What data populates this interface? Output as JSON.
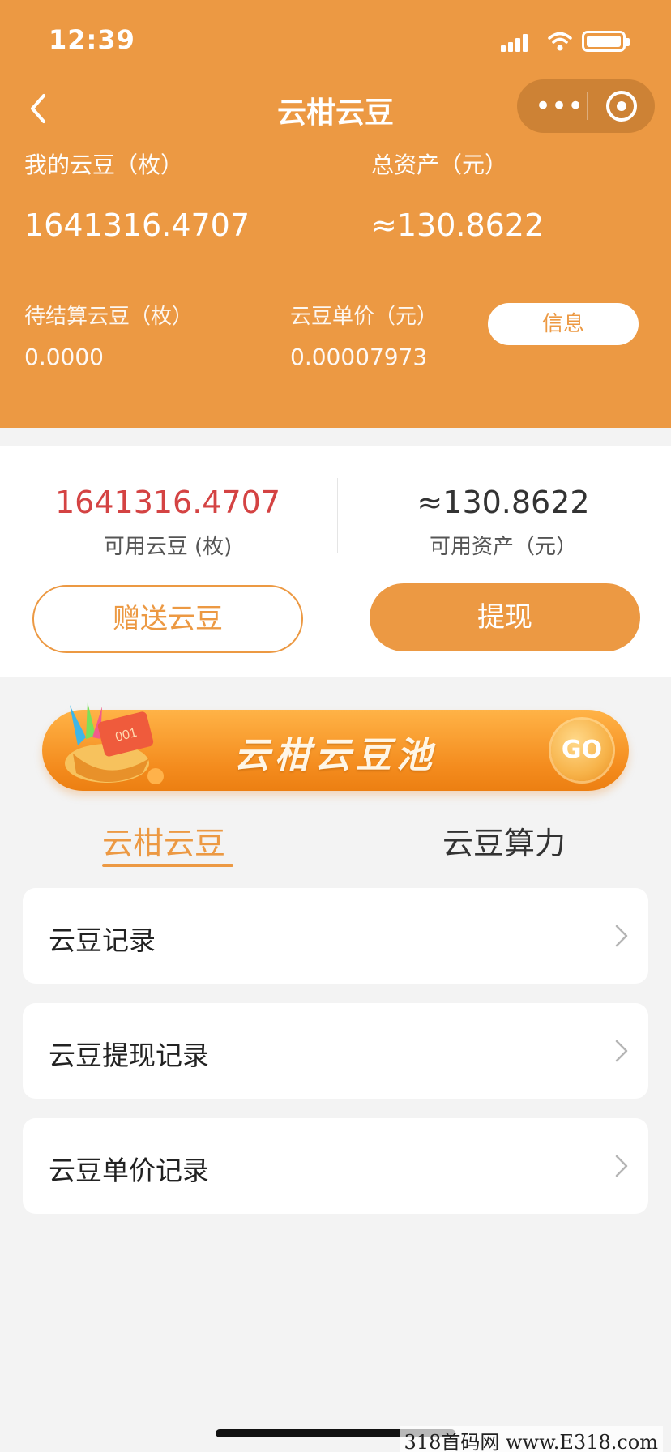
{
  "status_bar": {
    "time": "12:39"
  },
  "nav": {
    "back_icon": "chevron-left-icon",
    "title": "云柑云豆",
    "more_icon": "more-dots-icon",
    "close_icon": "target-circle-icon"
  },
  "header": {
    "my_beans_label": "我的云豆（枚）",
    "my_beans_value": "1641316.4707",
    "total_assets_label": "总资产（元）",
    "total_assets_value": "≈130.8622",
    "pending_label": "待结算云豆（枚）",
    "pending_value": "0.0000",
    "unit_price_label": "云豆单价（元）",
    "unit_price_value": "0.00007973",
    "info_button": "信息"
  },
  "balance": {
    "available_beans_value": "1641316.4707",
    "available_beans_label": "可用云豆 (枚)",
    "available_assets_value": "≈130.8622",
    "available_assets_label": "可用资产（元）",
    "gift_button": "赠送云豆",
    "withdraw_button": "提现"
  },
  "pool_banner": {
    "title": "云柑云豆池",
    "go_label": "GO",
    "badge_text": "001"
  },
  "tabs": [
    {
      "label": "云柑云豆",
      "active": true
    },
    {
      "label": "云豆算力",
      "active": false
    }
  ],
  "list": [
    {
      "label": "云豆记录"
    },
    {
      "label": "云豆提现记录"
    },
    {
      "label": "云豆单价记录"
    }
  ],
  "watermark": "318首码网 www.E318.com",
  "colors": {
    "accent": "#ec9943",
    "red_value": "#d44343",
    "background": "#f3f3f3"
  }
}
